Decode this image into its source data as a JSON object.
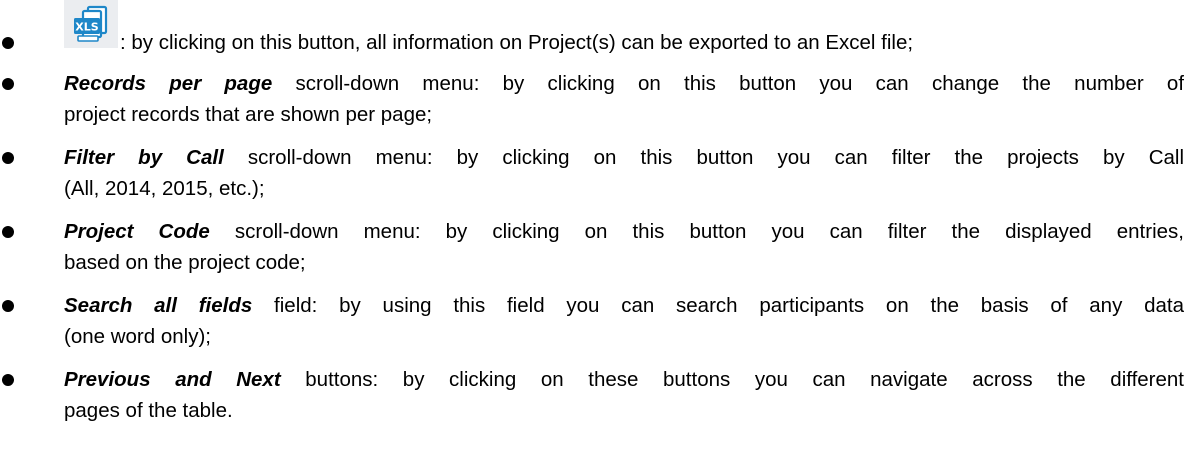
{
  "export_button": {
    "icon": "xls-export-icon",
    "icon_text": "XLS",
    "accent_color": "#1e87c8",
    "description": ": by clicking on this button, all information on Project(s) can be exported to an Excel file;"
  },
  "items": [
    {
      "term": "Records per page",
      "line1": " scroll-down menu: by clicking on this button you can change the number of",
      "line2": "project records that are shown per page;"
    },
    {
      "term": "Filter by Call",
      "line1": " scroll-down menu: by clicking on this button you can filter the projects by Call",
      "line2": "(All, 2014, 2015, etc.);"
    },
    {
      "term": "Project Code",
      "line1": " scroll-down menu: by clicking on this button you can filter the displayed entries,",
      "line2": "based on the project code;"
    },
    {
      "term": "Search all fields",
      "line1": " field: by using this field you can search participants on the basis of any data",
      "line2": "(one word only);"
    },
    {
      "term": "Previous and Next",
      "line1": " buttons: by clicking on these buttons you can navigate across the different",
      "line2": "pages of the table."
    }
  ]
}
